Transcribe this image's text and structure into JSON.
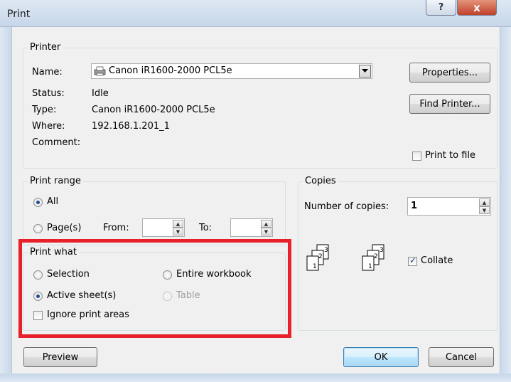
{
  "window": {
    "title": "Print",
    "help_label": "?",
    "close_label": "x"
  },
  "printer": {
    "group_label": "Printer",
    "name_label": "Name:",
    "name_value": "Canon iR1600-2000 PCL5e",
    "status_label": "Status:",
    "status_value": "Idle",
    "type_label": "Type:",
    "type_value": "Canon iR1600-2000 PCL5e",
    "where_label": "Where:",
    "where_value": "192.168.1.201_1",
    "comment_label": "Comment:",
    "properties_label": "Properties...",
    "find_printer_label": "Find Printer...",
    "print_to_file_label": "Print to file",
    "print_to_file_checked": false
  },
  "print_range": {
    "group_label": "Print range",
    "all_label": "All",
    "all_selected": true,
    "pages_label": "Page(s)",
    "from_label": "From:",
    "from_value": "",
    "to_label": "To:",
    "to_value": ""
  },
  "copies": {
    "group_label": "Copies",
    "number_label": "Number of copies:",
    "number_value": "1",
    "collate_label": "Collate",
    "collate_checked": true,
    "page_stack_numbers": [
      "1",
      "2",
      "3"
    ]
  },
  "print_what": {
    "group_label": "Print what",
    "selection_label": "Selection",
    "entire_workbook_label": "Entire workbook",
    "active_sheets_label": "Active sheet(s)",
    "active_sheets_selected": true,
    "table_label": "Table",
    "table_disabled": true,
    "ignore_print_areas_label": "Ignore print areas",
    "ignore_print_areas_checked": false
  },
  "footer": {
    "preview_label": "Preview",
    "ok_label": "OK",
    "cancel_label": "Cancel"
  },
  "colors": {
    "highlight_box": "#e8202a",
    "dialog_bg": "#f0f0f0",
    "title_bg": "#c6d6ea"
  },
  "icons": {
    "printer": "printer-icon",
    "dropdown": "chevron-down-icon",
    "pages": "stacked-pages-icon"
  }
}
